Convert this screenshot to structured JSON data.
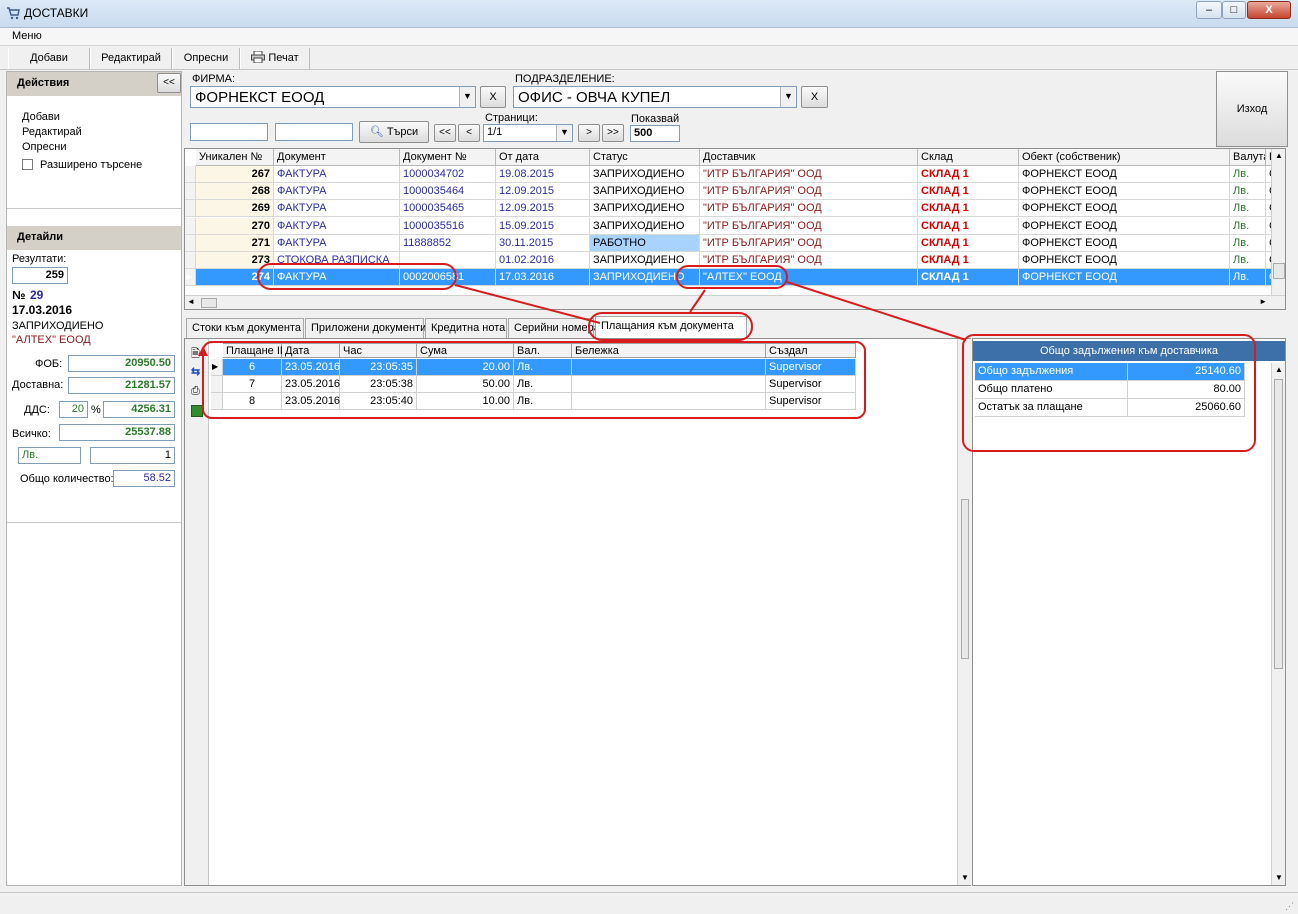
{
  "window": {
    "title": "ДОСТАВКИ",
    "min": "–",
    "max": "□",
    "close": "X"
  },
  "menu": {
    "label": "Меню"
  },
  "toolbar": {
    "add": "Добави",
    "edit": "Редактирай",
    "refresh": "Опресни",
    "print": "Печат"
  },
  "actions": {
    "header": "Действия",
    "collapse": "<<",
    "add": "Добави",
    "edit": "Редактирай",
    "refresh": "Опресни",
    "extended": "Разширено търсене"
  },
  "details": {
    "header": "Детайли",
    "results_label": "Резултати:",
    "results": "259",
    "num_prefix": "№",
    "num": "29",
    "date": "17.03.2016",
    "status": "ЗАПРИХОДИЕНО",
    "supplier": "\"АЛТЕХ\" ЕООД",
    "fob_label": "ФОБ:",
    "fob": "20950.50",
    "delivery_label": "Доставна:",
    "delivery": "21281.57",
    "vat_label": "ДДС:",
    "vat_pct": "20",
    "vat_pct_sign": "%",
    "vat": "4256.31",
    "total_label": "Всичко:",
    "total": "25537.88",
    "currency": "Лв.",
    "rate": "1",
    "qty_label": "Общо количество:",
    "qty": "58.52"
  },
  "filters": {
    "firm_label": "ФИРМА:",
    "firm": "ФОРНЕКСТ ЕООД",
    "dept_label": "ПОДРАЗДЕЛЕНИЕ:",
    "dept": "ОФИС - ОВЧА КУПЕЛ",
    "clear": "X",
    "search": "Търси",
    "first": "<<",
    "prev": "<",
    "next": ">",
    "last": ">>",
    "pages_label": "Страници:",
    "pages": "1/1",
    "show_label": "Показвай",
    "show": "500",
    "exit": "Изход"
  },
  "grid": {
    "columns": [
      "Уникален №",
      "Документ",
      "Документ №",
      "От дата",
      "Статус",
      "Доставчик",
      "Склад",
      "Обект (собственик)",
      "Валута",
      "Бе"
    ],
    "rows": [
      {
        "id": "267",
        "doc": "ФАКТУРА",
        "docno": "1000034702",
        "date": "19.08.2015",
        "status": "ЗАПРИХОДИЕНО",
        "supplier": "\"ИТР БЪЛГАРИЯ\" ООД",
        "store": "СКЛАД 1",
        "object": "ФОРНЕКСТ ЕООД",
        "cur": "Лв.",
        "be": "Съ"
      },
      {
        "id": "268",
        "doc": "ФАКТУРА",
        "docno": "1000035464",
        "date": "12.09.2015",
        "status": "ЗАПРИХОДИЕНО",
        "supplier": "\"ИТР БЪЛГАРИЯ\" ООД",
        "store": "СКЛАД 1",
        "object": "ФОРНЕКСТ ЕООД",
        "cur": "Лв.",
        "be": "Съ"
      },
      {
        "id": "269",
        "doc": "ФАКТУРА",
        "docno": "1000035465",
        "date": "12.09.2015",
        "status": "ЗАПРИХОДИЕНО",
        "supplier": "\"ИТР БЪЛГАРИЯ\" ООД",
        "store": "СКЛАД 1",
        "object": "ФОРНЕКСТ ЕООД",
        "cur": "Лв.",
        "be": "Съ"
      },
      {
        "id": "270",
        "doc": "ФАКТУРА",
        "docno": "1000035516",
        "date": "15.09.2015",
        "status": "ЗАПРИХОДИЕНО",
        "supplier": "\"ИТР БЪЛГАРИЯ\" ООД",
        "store": "СКЛАД 1",
        "object": "ФОРНЕКСТ ЕООД",
        "cur": "Лв.",
        "be": "Съ"
      },
      {
        "id": "271",
        "doc": "ФАКТУРА",
        "docno": "11888852",
        "date": "30.11.2015",
        "status": "РАБОТНО",
        "supplier": "\"ИТР БЪЛГАРИЯ\" ООД",
        "store": "СКЛАД 1",
        "object": "ФОРНЕКСТ ЕООД",
        "cur": "Лв.",
        "be": "Съ"
      },
      {
        "id": "273",
        "doc": "СТОКОВА РАЗПИСКА",
        "docno": "",
        "date": "01.02.2016",
        "status": "ЗАПРИХОДИЕНО",
        "supplier": "\"ИТР БЪЛГАРИЯ\" ООД",
        "store": "СКЛАД 1",
        "object": "ФОРНЕКСТ ЕООД",
        "cur": "Лв.",
        "be": "Съ"
      },
      {
        "id": "274",
        "doc": "ФАКТУРА",
        "docno": "0002006581",
        "date": "17.03.2016",
        "status": "ЗАПРИХОДИЕНО",
        "supplier": "\"АЛТЕХ\" ЕООД",
        "store": "СКЛАД 1",
        "object": "ФОРНЕКСТ ЕООД",
        "cur": "Лв.",
        "be": "Съ"
      }
    ]
  },
  "tabs": [
    "Стоки към документа",
    "Приложени документи",
    "Кредитна нота",
    "Серийни номера",
    "Плащания към документа"
  ],
  "payments": {
    "columns": [
      "Плащане ID",
      "Дата",
      "Час",
      "Сума",
      "Вал.",
      "Бележка",
      "Създал"
    ],
    "rows": [
      {
        "id": "6",
        "date": "23.05.2016",
        "time": "23:05:35",
        "sum": "20.00",
        "cur": "Лв.",
        "note": "",
        "by": "Supervisor"
      },
      {
        "id": "7",
        "date": "23.05.2016",
        "time": "23:05:38",
        "sum": "50.00",
        "cur": "Лв.",
        "note": "",
        "by": "Supervisor"
      },
      {
        "id": "8",
        "date": "23.05.2016",
        "time": "23:05:40",
        "sum": "10.00",
        "cur": "Лв.",
        "note": "",
        "by": "Supervisor"
      }
    ]
  },
  "summary": {
    "title": "Общо задължения към доставчика",
    "rows": [
      {
        "label": "Общо задължения",
        "value": "25140.60"
      },
      {
        "label": "Общо платено",
        "value": "80.00"
      },
      {
        "label": "Остатък за плащане",
        "value": "25060.60"
      }
    ]
  },
  "colors": {
    "selection": "#3399ff",
    "annotation": "#d81c1c",
    "store_red": "#d40000"
  }
}
